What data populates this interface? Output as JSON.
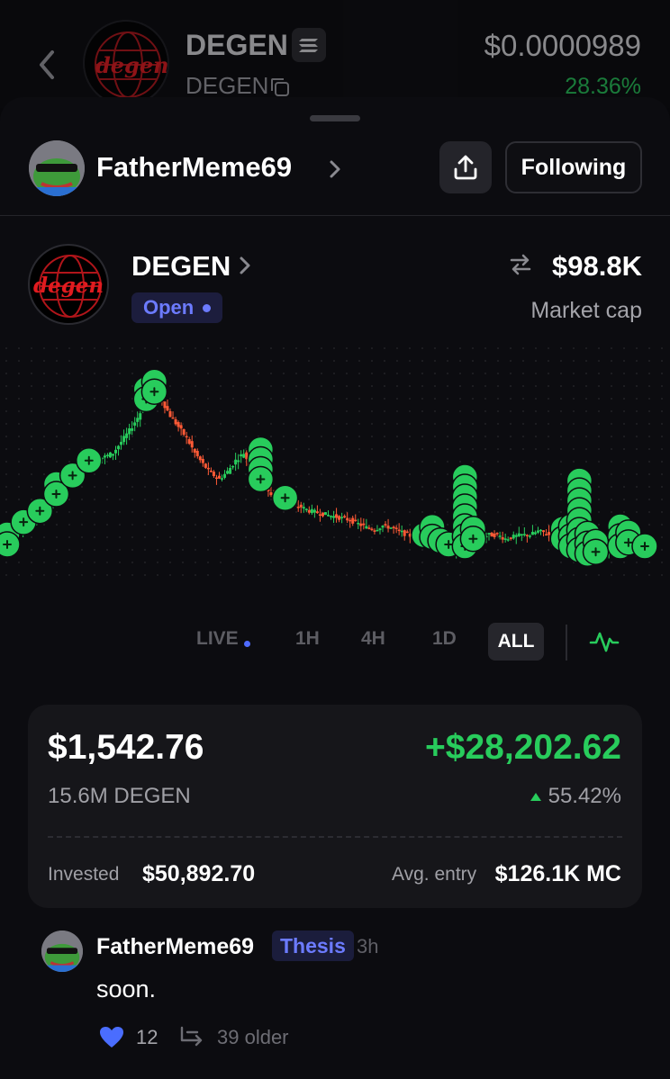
{
  "background_header": {
    "token_name": "DEGEN",
    "ticker": "DEGEN",
    "price": "$0.0000989",
    "change": "28.36%",
    "logo_text": "degen"
  },
  "profile": {
    "username": "FatherMeme69",
    "follow_label": "Following"
  },
  "token": {
    "name": "DEGEN",
    "logo_text": "degen",
    "status": "Open",
    "market_cap": "$98.8K",
    "market_cap_label": "Market cap"
  },
  "colors": {
    "green": "#28cc5c",
    "red": "#ff5a36",
    "accent_blue": "#6c7bff"
  },
  "chart_data": {
    "type": "candlestick",
    "x": [],
    "title": "",
    "notes": "Price history candles with green buy-trade markers (plus icons) along the series",
    "close_relative": [
      0.15,
      0.22,
      0.27,
      0.3,
      0.33,
      0.36,
      0.42,
      0.48,
      0.52,
      0.56,
      0.6,
      0.63,
      0.64,
      0.66,
      0.72,
      0.78,
      0.85,
      0.93,
      0.97,
      0.94,
      0.86,
      0.8,
      0.74,
      0.66,
      0.6,
      0.55,
      0.52,
      0.56,
      0.62,
      0.66,
      0.57,
      0.5,
      0.45,
      0.42,
      0.4,
      0.38,
      0.37,
      0.35,
      0.34,
      0.33,
      0.32,
      0.31,
      0.3,
      0.28,
      0.26,
      0.25,
      0.27,
      0.26,
      0.24,
      0.22,
      0.21,
      0.2,
      0.19,
      0.17,
      0.15,
      0.13,
      0.14,
      0.18,
      0.21,
      0.22,
      0.22,
      0.2,
      0.21,
      0.22,
      0.22,
      0.24,
      0.23,
      0.2,
      0.18,
      0.14,
      0.12,
      0.1,
      0.11,
      0.12,
      0.13,
      0.14,
      0.16,
      0.15,
      0.14
    ]
  },
  "timeframes": {
    "options": [
      "LIVE",
      "1H",
      "4H",
      "1D",
      "ALL"
    ],
    "selected": "ALL"
  },
  "position": {
    "value": "$1,542.76",
    "pnl": "+$28,202.62",
    "amount": "15.6M DEGEN",
    "pnl_percent": "55.42%",
    "invested_label": "Invested",
    "invested_value": "$50,892.70",
    "avg_entry_label": "Avg. entry",
    "avg_entry_value": "$126.1K MC"
  },
  "comment": {
    "username": "FatherMeme69",
    "tag": "Thesis",
    "time": "3h",
    "text": "soon.",
    "likes": "12",
    "older": "39 older"
  }
}
